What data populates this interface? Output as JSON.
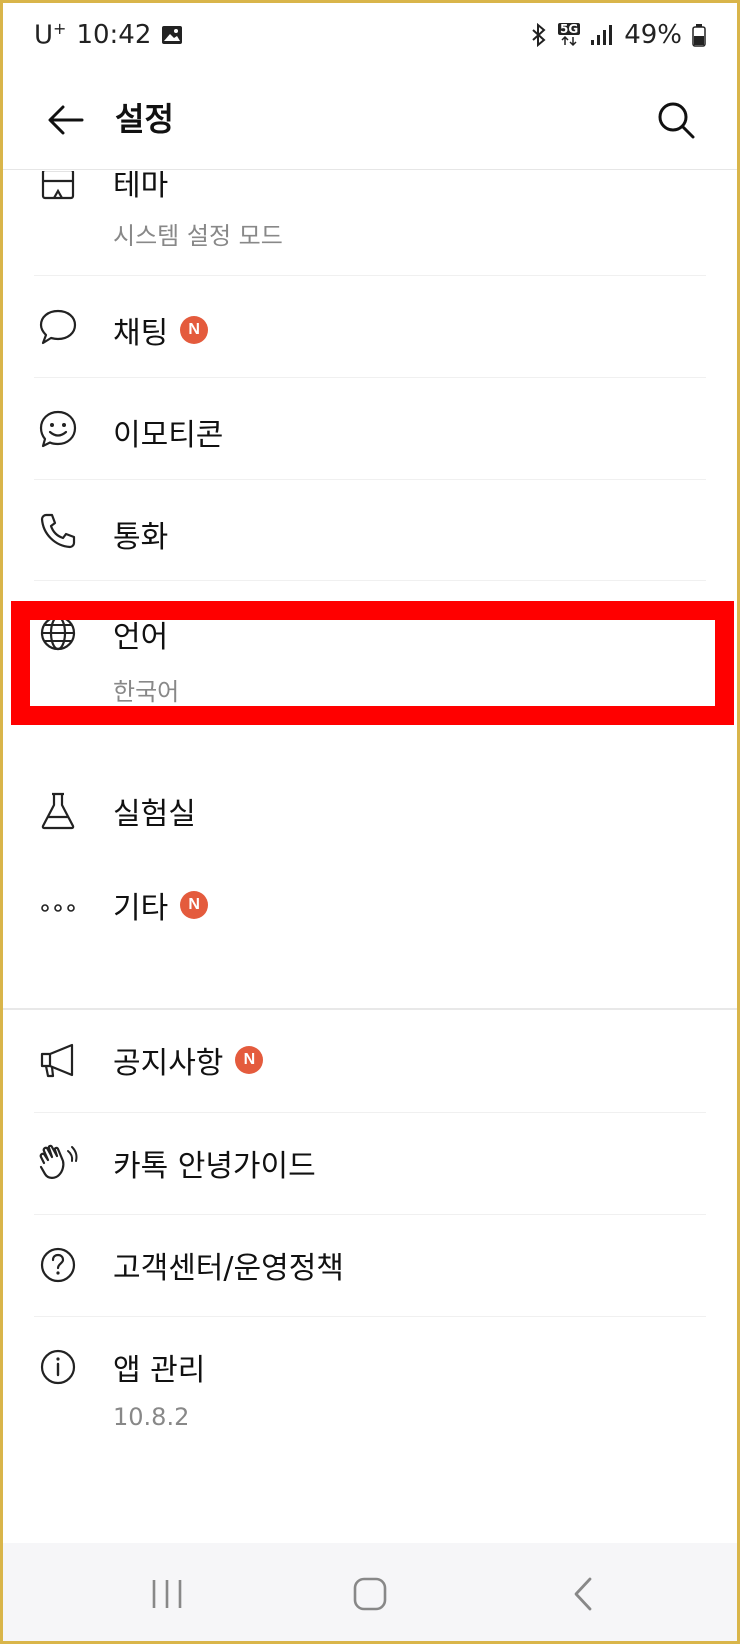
{
  "status_bar": {
    "carrier": "U",
    "carrier_sup": "+",
    "time": "10:42",
    "network": "5G",
    "battery": "49%"
  },
  "header": {
    "title": "설정",
    "back_icon": "back-arrow-icon",
    "search_icon": "search-icon"
  },
  "menu": {
    "theme": {
      "label": "테마",
      "sub": "시스템 설정 모드",
      "icon": "theme-icon"
    },
    "chat": {
      "label": "채팅",
      "badge": "N",
      "icon": "chat-bubble-icon"
    },
    "emoticon": {
      "label": "이모티콘",
      "icon": "emoticon-icon"
    },
    "call": {
      "label": "통화",
      "icon": "phone-icon"
    },
    "language": {
      "label": "언어",
      "sub": "한국어",
      "icon": "globe-icon"
    },
    "lab": {
      "label": "실험실",
      "icon": "flask-icon"
    },
    "etc": {
      "label": "기타",
      "badge": "N",
      "icon": "more-icon"
    }
  },
  "support": {
    "notice": {
      "label": "공지사항",
      "badge": "N",
      "icon": "megaphone-icon"
    },
    "guide": {
      "label": "카톡 안녕가이드",
      "icon": "waving-hand-icon"
    },
    "help": {
      "label": "고객센터/운영정책",
      "icon": "question-icon"
    },
    "app_manage": {
      "label": "앱 관리",
      "sub": "10.8.2",
      "icon": "info-icon"
    }
  },
  "colors": {
    "badge": "#e45b3d",
    "highlight": "#ff0000",
    "frame": "#d9b54a"
  }
}
